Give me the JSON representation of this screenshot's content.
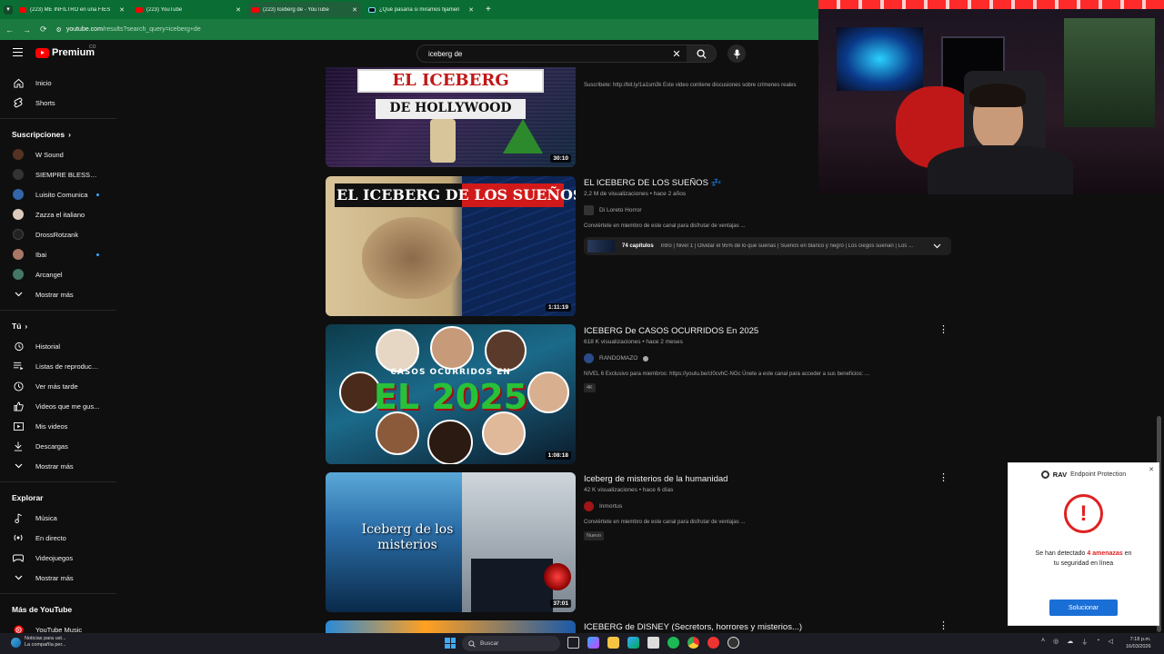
{
  "browser": {
    "tabs": [
      {
        "title": "(223) ME INFILTRO en una FIES",
        "active": false,
        "icon": "youtube"
      },
      {
        "title": "(223) YouTube",
        "active": false,
        "icon": "youtube"
      },
      {
        "title": "(223) Iceberg de - YouTube",
        "active": true,
        "icon": "youtube"
      },
      {
        "title": "¿Qué pasaría si miramos fijamen",
        "active": false,
        "icon": "tiktok"
      }
    ],
    "url_host": "youtube.com",
    "url_path": "/results?search_query=iceberg+de",
    "accent": "#0a6d33"
  },
  "masthead": {
    "logo_text": "Premium",
    "country_code": "CO",
    "search_query": "iceberg de"
  },
  "sidebar": {
    "main": [
      {
        "label": "Inicio",
        "icon": "home-icon"
      },
      {
        "label": "Shorts",
        "icon": "shorts-icon"
      }
    ],
    "subs_header": "Suscripciones",
    "subs": [
      {
        "label": "W Sound",
        "color": "#553322",
        "dot": false
      },
      {
        "label": "SIEMPRE BLESSD ...",
        "color": "#333333",
        "dot": false
      },
      {
        "label": "Luisito Comunica",
        "color": "#3366aa",
        "dot": true
      },
      {
        "label": "Zazza el italiano",
        "color": "#ddccbb",
        "dot": false
      },
      {
        "label": "DrossRotzank",
        "color": "#222222",
        "dot": false
      },
      {
        "label": "Ibai",
        "color": "#aa7766",
        "dot": true
      },
      {
        "label": "Arcangel",
        "color": "#447766",
        "dot": false
      }
    ],
    "subs_more": "Mostrar más",
    "you_header": "Tú",
    "you": [
      {
        "label": "Historial",
        "icon": "history-icon"
      },
      {
        "label": "Listas de reproducción",
        "icon": "playlist-icon"
      },
      {
        "label": "Ver más tarde",
        "icon": "clock-icon"
      },
      {
        "label": "Videos que me gus...",
        "icon": "thumbs-up-icon"
      },
      {
        "label": "Mis videos",
        "icon": "video-icon"
      },
      {
        "label": "Descargas",
        "icon": "download-icon"
      }
    ],
    "you_more": "Mostrar más",
    "explore_header": "Explorar",
    "explore": [
      {
        "label": "Música",
        "icon": "music-icon"
      },
      {
        "label": "En directo",
        "icon": "live-icon"
      },
      {
        "label": "Videojuegos",
        "icon": "gaming-icon"
      }
    ],
    "explore_more": "Mostrar más",
    "more_header": "Más de YouTube",
    "more": [
      {
        "label": "YouTube Music",
        "icon": "youtube-music-icon"
      }
    ]
  },
  "videos": [
    {
      "title": "",
      "stats": "",
      "channel": "",
      "description": "Suscríbete: http://bit.ly/1a1sm3k Este video contiene discusiones sobre crímenes reales",
      "duration": "30:10",
      "thumb_text1": "EL ICEBERG",
      "thumb_text2": "DE HOLLYWOOD"
    },
    {
      "title": "EL ICEBERG DE LOS SUEÑOS 💤",
      "stats": "2,2 M de visualizaciones • hace 2 años",
      "channel": "Di Loreto Horror",
      "description": "Conviértete en miembro de este canal para disfrutar de ventajas ...",
      "duration": "1:11:19",
      "thumb_text1": "EL ICEBERG DE LOS SUEÑOS",
      "chapters_count": "74 capítulos",
      "chapters_summary": "Intro | Nivel 1 | Olvidar el 95% de lo que sueñas | Sueños en blanco y negro | Los ciegos sueñan | Los ..."
    },
    {
      "title": "ICEBERG De CASOS OCURRIDOS En 2025",
      "stats": "618 K visualizaciones • hace 2 meses",
      "channel": "RANDOMAZO",
      "verified": true,
      "description": "NIVEL 6 Exclusivo para miembros: https://youtu.be/cI0cvhC-NGc Únete a este canal para acceder a sus beneficios: ...",
      "badge": "4K",
      "duration": "1:08:18",
      "thumb_text1": "CASOS OCURRIDOS EN",
      "thumb_text2": "EL 2025"
    },
    {
      "title": "Iceberg de misterios de la humanidad",
      "stats": "42 K visualizaciones • hace 6 días",
      "channel": "Inmortus",
      "description": "Conviértete en miembro de este canal para disfrutar de ventajas ...",
      "badge": "Nuevo",
      "duration": "37:01",
      "thumb_text1": "Iceberg de los",
      "thumb_text2": "misterios"
    },
    {
      "title": "ICEBERG de DISNEY (Secretors, horrores y misterios...)"
    }
  ],
  "popup": {
    "brand": "RAV",
    "product": "Endpoint Protection",
    "message_pre": "Se han detectado",
    "threat_count": "4 amenazas",
    "message_mid": "en",
    "message_post": "tu seguridad en línea",
    "button": "Solucionar"
  },
  "taskbar": {
    "news_title": "Noticias para ust...",
    "news_sub": "La compañía per...",
    "search_label": "Buscar",
    "time": "7:18 p.m.",
    "date": "16/03/2026"
  }
}
